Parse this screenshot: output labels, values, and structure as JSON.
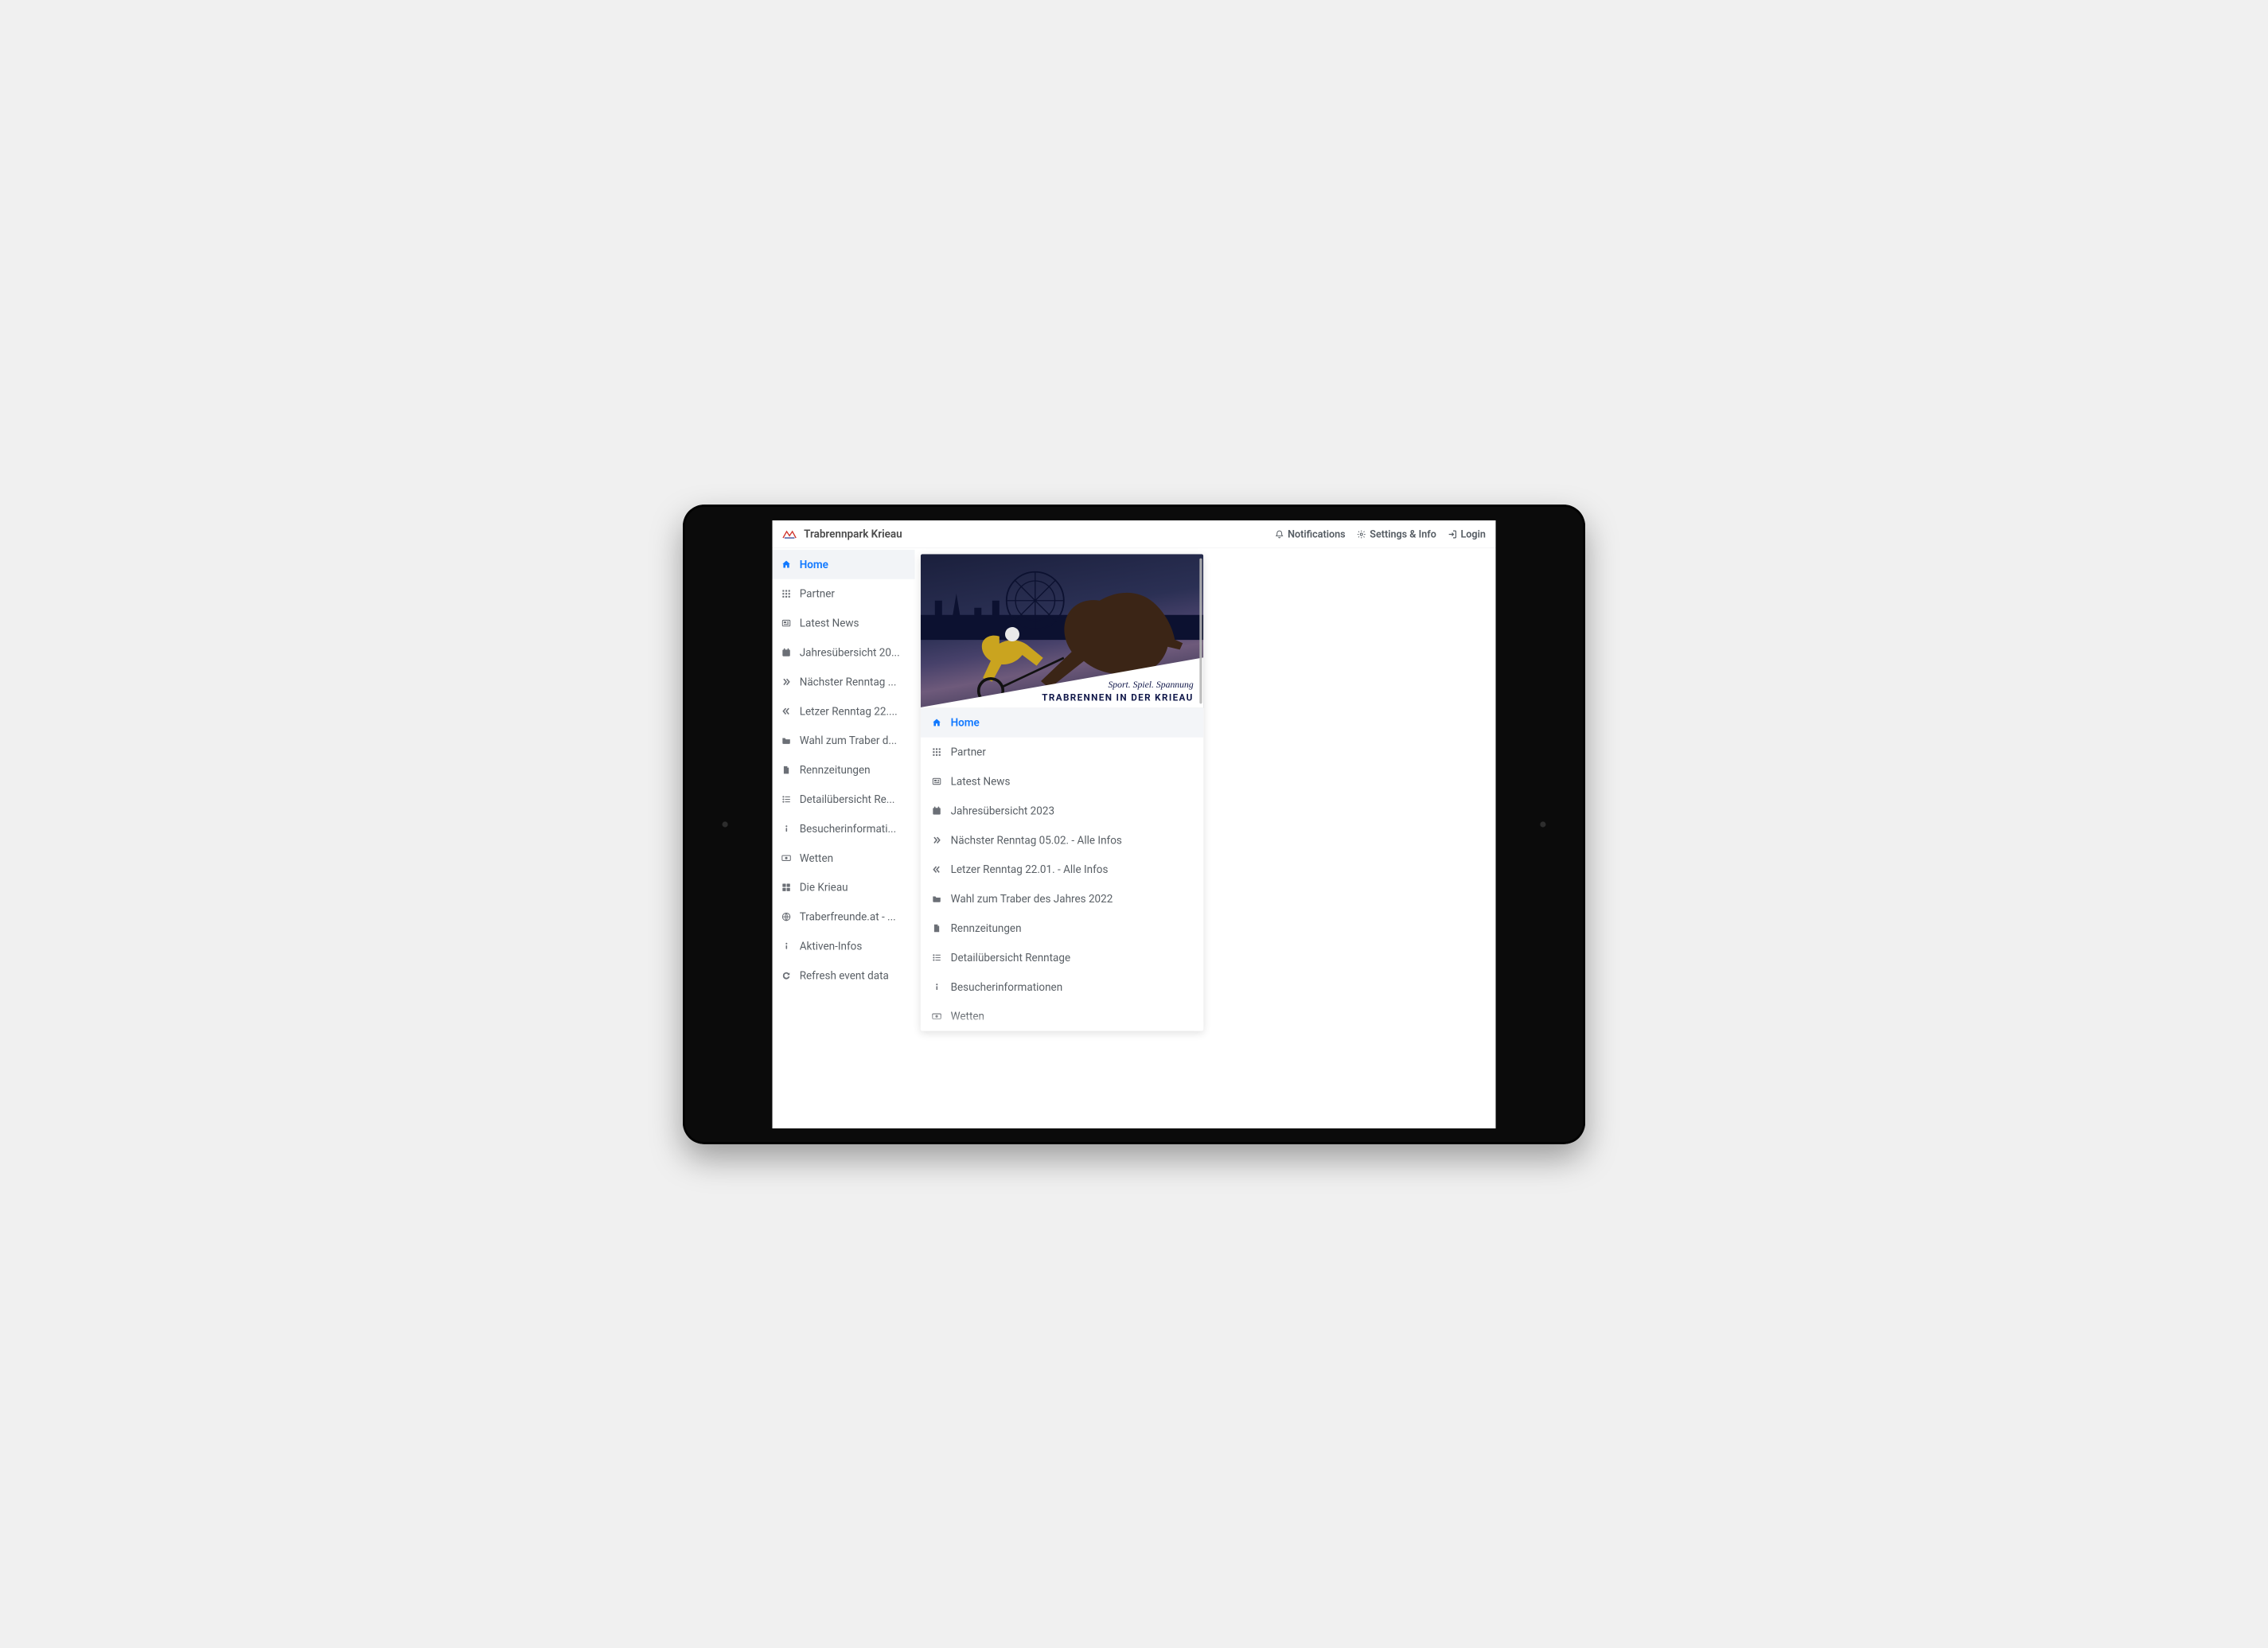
{
  "header": {
    "brand": "Trabrennpark Krieau",
    "notifications": "Notifications",
    "settings": "Settings & Info",
    "login": "Login"
  },
  "hero": {
    "tagline": "Sport. Spiel. Spannung",
    "title": "TRABRENNEN IN DER KRIEAU"
  },
  "nav": {
    "items": [
      {
        "icon": "home",
        "label": "Home",
        "active": true
      },
      {
        "icon": "grid",
        "label": "Partner"
      },
      {
        "icon": "news",
        "label": "Latest News"
      },
      {
        "icon": "calendar",
        "label": "Jahresübersicht 2023",
        "short": "Jahresübersicht 20..."
      },
      {
        "icon": "chev-r2",
        "label": "Nächster Renntag 05.02. - Alle Infos",
        "short": "Nächster Renntag ..."
      },
      {
        "icon": "chev-l2",
        "label": "Letzer Renntag 22.01. - Alle Infos",
        "short": "Letzer Renntag 22...."
      },
      {
        "icon": "folder",
        "label": "Wahl zum Traber des Jahres 2022",
        "short": "Wahl zum Traber d..."
      },
      {
        "icon": "file",
        "label": "Rennzeitungen"
      },
      {
        "icon": "list",
        "label": "Detailübersicht Renntage",
        "short": "Detailübersicht Re..."
      },
      {
        "icon": "info",
        "label": "Besucherinformationen",
        "short": "Besucherinformati..."
      },
      {
        "icon": "money",
        "label": "Wetten"
      },
      {
        "icon": "grid4",
        "label": "Die Krieau"
      },
      {
        "icon": "globe",
        "label": "Traberfreunde.at - ...",
        "short": "Traberfreunde.at - ..."
      },
      {
        "icon": "info",
        "label": "Aktiven-Infos"
      },
      {
        "icon": "refresh",
        "label": "Refresh event data"
      }
    ]
  }
}
